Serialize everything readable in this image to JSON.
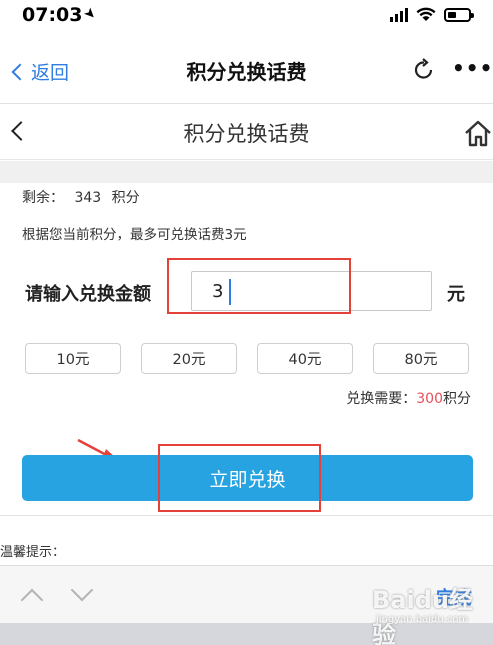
{
  "status_bar": {
    "time": "07:03",
    "arrow": "➤"
  },
  "navbar": {
    "back_label": "返回",
    "title": "积分兑换话费",
    "more": "•••"
  },
  "header": {
    "title": "积分兑换话费"
  },
  "balance": {
    "label": "剩余：",
    "value": "343",
    "unit": "积分"
  },
  "hint": "根据您当前积分，最多可兑换话费3元",
  "amount": {
    "label": "请输入兑换金额",
    "value": "3",
    "unit": "元"
  },
  "options": [
    "10元",
    "20元",
    "40元",
    "80元"
  ],
  "need": {
    "label": "兑换需要：",
    "value": "300",
    "unit": "积分"
  },
  "redeem_button": "立即兑换",
  "tips": "温馨提示：",
  "keyboard_bar": {
    "done": "完成"
  },
  "watermark": {
    "brand": "Baidu经验",
    "url": "jingyan.baidu.com"
  },
  "colors": {
    "accent_blue": "#2f7de1",
    "button_blue": "#27a3e1",
    "highlight_red": "#e5413b",
    "points_red": "#e8515a"
  }
}
